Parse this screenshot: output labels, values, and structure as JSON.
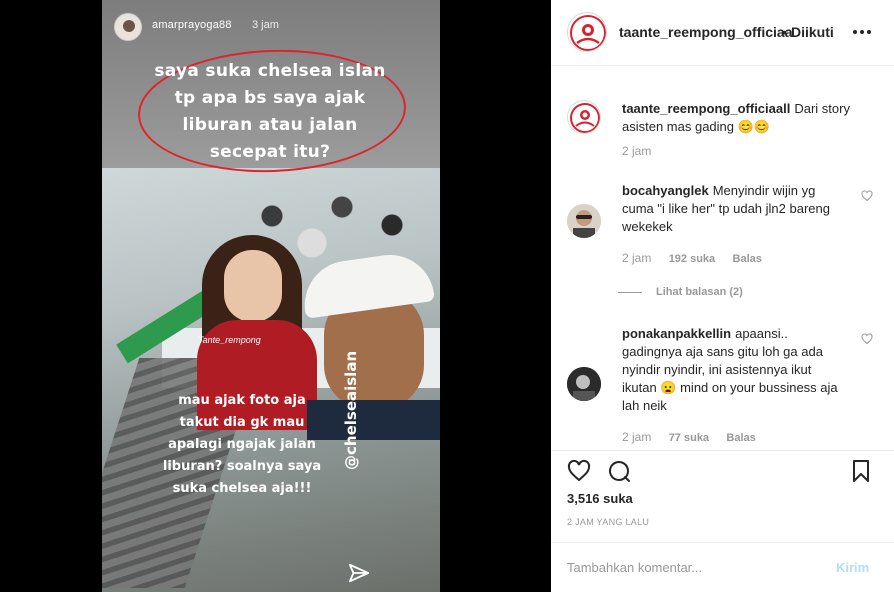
{
  "story": {
    "username": "amarprayoga88",
    "time": "3 jam",
    "caption_top": "saya suka chelsea islan tp apa bs saya ajak liburan atau jalan secepat itu?",
    "watermark": "Tante_rempong",
    "caption_bottom": "mau ajak foto aja takut dia gk mau apalagi ngajak jalan liburan? soalnya saya suka chelsea aja!!!",
    "mention": "@chelseaislan",
    "accent_color": "#e0232b"
  },
  "header": {
    "username": "taante_reempong_officiaa",
    "separator": "•",
    "follow_label": "Diikuti"
  },
  "caption": {
    "username": "taante_reempong_officiaall",
    "text": "Dari story asisten mas gading 😊😊",
    "time": "2 jam"
  },
  "comments": [
    {
      "username": "bocahyanglek",
      "text": "Menyindir wijin yg cuma \"i like her\" tp udah jln2 bareng wekekek",
      "time": "2 jam",
      "likes": "192 suka",
      "reply_label": "Balas"
    },
    {
      "username": "ponakanpakkellin",
      "text": "apaansi.. gadingnya aja sans gitu loh ga ada nyindir nyindir, ini asistennya ikut ikutan 😦 mind on your bussiness aja lah neik",
      "time": "2 jam",
      "likes": "77 suka",
      "reply_label": "Balas"
    }
  ],
  "view_replies_label": "Lihat balasan (2)",
  "actions": {
    "likes": "3,516 suka",
    "posted": "2 JAM YANG LALU"
  },
  "add_comment": {
    "placeholder": "Tambahkan komentar...",
    "post_label": "Kirim"
  }
}
